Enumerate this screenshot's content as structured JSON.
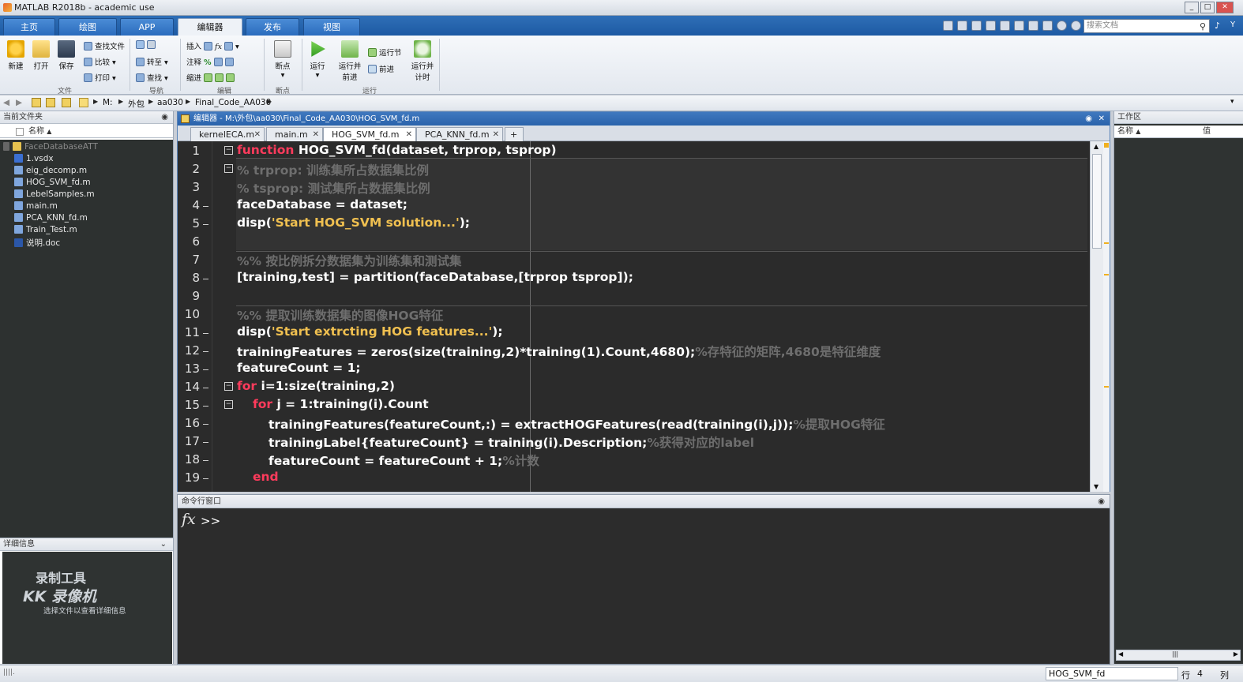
{
  "window": {
    "title": "MATLAB R2018b - academic use"
  },
  "ribbon_tabs": [
    {
      "label": "主页"
    },
    {
      "label": "绘图"
    },
    {
      "label": "APP"
    },
    {
      "label": "编辑器"
    },
    {
      "label": "发布"
    },
    {
      "label": "视图"
    }
  ],
  "search": {
    "placeholder": "搜索文档"
  },
  "user_initial": "Y",
  "toolbar": {
    "new": "新建",
    "open": "打开",
    "save": "保存",
    "find_file": "查找文件",
    "compare": "比较",
    "print": "打印",
    "goto": "转至",
    "find": "查找",
    "insert": "插入",
    "comment": "注释",
    "indent": "缩进",
    "breakpoints": "断点",
    "run": "运行",
    "run_advance_1": "运行并",
    "run_advance_2": "前进",
    "run_section": "运行节",
    "advance": "前进",
    "run_time_1": "运行并",
    "run_time_2": "计时"
  },
  "groups": {
    "file": "文件",
    "navigate": "导航",
    "edit": "编辑",
    "breakpoints": "断点",
    "run": "运行"
  },
  "address": {
    "segments": [
      "M:",
      "外包",
      "aa030",
      "Final_Code_AA030"
    ]
  },
  "current_folder": {
    "title": "当前文件夹",
    "col_name": "名称",
    "root": "FaceDatabaseATT",
    "files": [
      "1.vsdx",
      "eig_decomp.m",
      "HOG_SVM_fd.m",
      "LebelSamples.m",
      "main.m",
      "PCA_KNN_fd.m",
      "Train_Test.m",
      "说明.doc"
    ]
  },
  "details": {
    "title": "详细信息",
    "watermark1": "录制工具",
    "watermark2": "KK 录像机",
    "hint": "选择文件以查看详细信息"
  },
  "editor": {
    "title": "编辑器 - M:\\外包\\aa030\\Final_Code_AA030\\HOG_SVM_fd.m",
    "tabs": [
      "kernelECA.m",
      "main.m",
      "HOG_SVM_fd.m",
      "PCA_KNN_fd.m"
    ],
    "add_tab": "+",
    "line_numbers": [
      "1",
      "2",
      "3",
      "4",
      "5",
      "6",
      "7",
      "8",
      "9",
      "10",
      "11",
      "12",
      "13",
      "14",
      "15",
      "16",
      "17",
      "18",
      "19"
    ],
    "code": {
      "l1_kw": "function",
      "l1_rest": " HOG_SVM_fd(dataset, trprop, tsprop)",
      "l2": "% trprop: 训练集所占数据集比例",
      "l3": "% tsprop: 测试集所占数据集比例",
      "l4": "faceDatabase = dataset;",
      "l5_a": "disp(",
      "l5_s": "'Start HOG_SVM solution...'",
      "l5_b": ");",
      "l7": "%% 按比例拆分数据集为训练集和测试集",
      "l8": "[training,test] = partition(faceDatabase,[trprop tsprop]);",
      "l10": "%% 提取训练数据集的图像HOG特征",
      "l11_a": "disp(",
      "l11_s": "'Start extrcting HOG features...'",
      "l11_b": ");",
      "l12_a": "trainingFeatures = zeros(size(training,2)*training(1).Count,4680);",
      "l12_c": "%存特征的矩阵,4680是特征维度",
      "l13": "featureCount = 1;",
      "l14_kw": "for",
      "l14_rest": " i=1:size(training,2)",
      "l15_kw": "for",
      "l15_rest": " j = 1:training(i).Count",
      "l16_a": "trainingFeatures(featureCount,:) = extractHOGFeatures(read(training(i),j));",
      "l16_c": "%提取HOG特征",
      "l17_a": "trainingLabel{featureCount} = training(i).Description;",
      "l17_c": "%获得对应的label",
      "l18_a": "featureCount = featureCount + 1;",
      "l18_c": "%计数",
      "l19_kw": "end"
    }
  },
  "command_window": {
    "title": "命令行窗口",
    "fx": "fx",
    "prompt": ">>"
  },
  "workspace": {
    "title": "工作区",
    "col_name": "名称",
    "col_value": "值"
  },
  "status": {
    "function_name": "HOG_SVM_fd",
    "row_label": "行",
    "row_value": "4",
    "col_label": "列"
  }
}
